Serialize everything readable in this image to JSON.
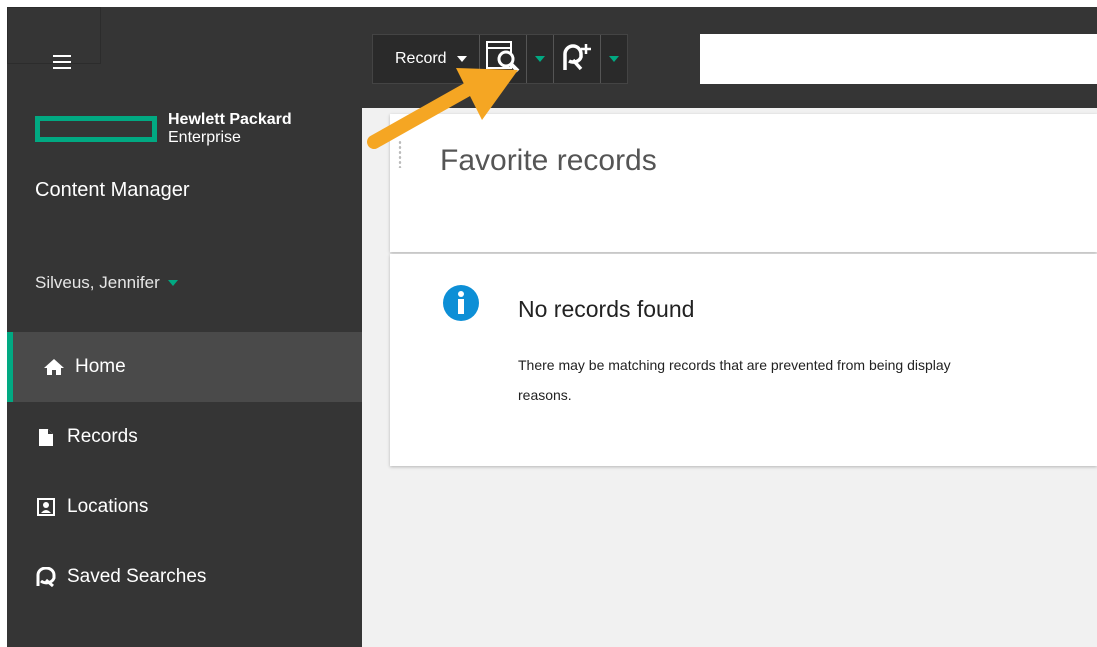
{
  "brand": {
    "company_line1": "Hewlett Packard",
    "company_line2": "Enterprise",
    "app_name": "Content Manager",
    "accent_color": "#01a982"
  },
  "user": {
    "name": "Silveus, Jennifer"
  },
  "sidebar": {
    "items": [
      {
        "label": "Home",
        "icon": "home-icon",
        "active": true
      },
      {
        "label": "Records",
        "icon": "document-icon",
        "active": false
      },
      {
        "label": "Locations",
        "icon": "contact-card-icon",
        "active": false
      },
      {
        "label": "Saved Searches",
        "icon": "saved-search-icon",
        "active": false
      }
    ]
  },
  "toolbar": {
    "record_label": "Record",
    "search_button_icon": "record-search-icon",
    "new_search_icon": "new-saved-search-icon",
    "search_value": ""
  },
  "favorites": {
    "title": "Favorite records"
  },
  "empty_state": {
    "icon": "info-icon",
    "title": "No records found",
    "message": "There may be matching records that are prevented from being display\nreasons."
  },
  "annotation": {
    "arrow_color": "#f5a623"
  }
}
